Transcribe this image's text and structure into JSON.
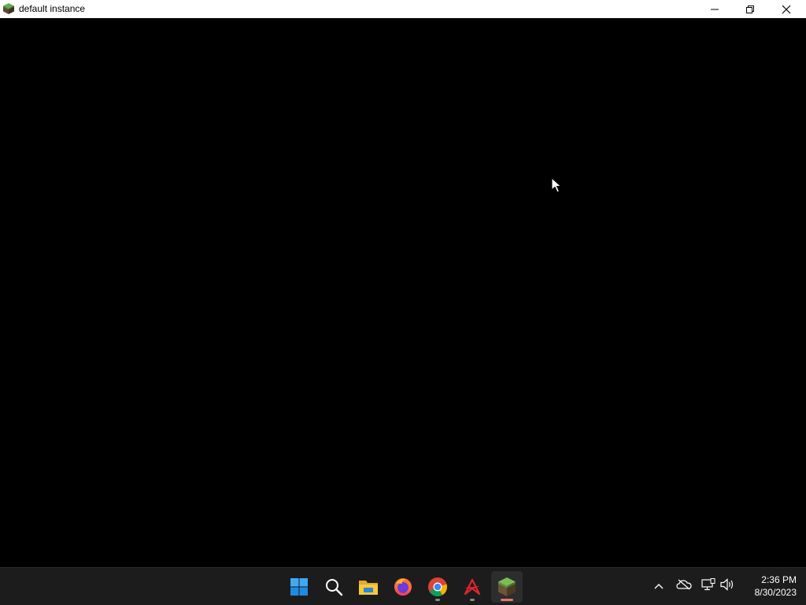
{
  "window": {
    "title": "default instance",
    "icon": "minecraft-grass-block-icon",
    "controls": {
      "minimize": "minimize-icon",
      "restore": "restore-icon",
      "close": "close-icon"
    }
  },
  "taskbar": {
    "apps": [
      {
        "name": "start",
        "icon": "windows-start-icon"
      },
      {
        "name": "search",
        "icon": "search-icon"
      },
      {
        "name": "file-explorer",
        "icon": "folder-icon"
      },
      {
        "name": "firefox",
        "icon": "firefox-icon"
      },
      {
        "name": "chrome",
        "icon": "chrome-icon",
        "running": true
      },
      {
        "name": "acrobat",
        "icon": "acrobat-icon",
        "running": true
      },
      {
        "name": "minecraft",
        "icon": "minecraft-grass-block-icon",
        "running": true,
        "active": true
      }
    ],
    "tray": {
      "icons": [
        "chevron-up-icon",
        "onedrive-offline-icon",
        "network-icon",
        "volume-icon"
      ]
    },
    "clock": {
      "time": "2:36 PM",
      "date": "8/30/2023"
    }
  },
  "colors": {
    "titlebar_bg": "#ffffff",
    "content_bg": "#000000",
    "taskbar_bg": "#1c1c1c",
    "active_indicator": "#e07a6a"
  }
}
